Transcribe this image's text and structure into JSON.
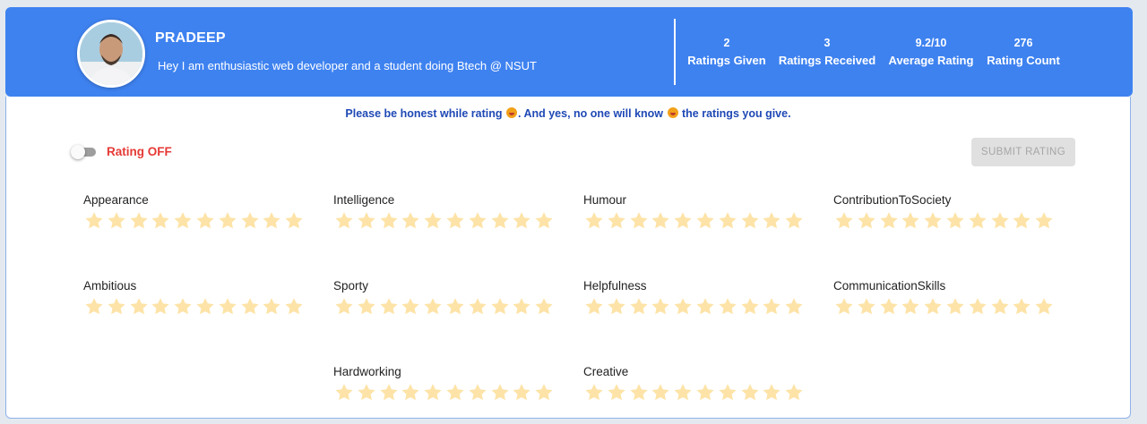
{
  "profile": {
    "name": "PRADEEP",
    "bio": "Hey I am enthusiastic web developer and a student doing Btech @ NSUT"
  },
  "stats": [
    {
      "value": "2",
      "label": "Ratings Given"
    },
    {
      "value": "3",
      "label": "Ratings Received"
    },
    {
      "value": "9.2/10",
      "label": "Average Rating"
    },
    {
      "value": "276",
      "label": "Rating Count"
    }
  ],
  "notice": {
    "part1": "Please be honest while rating",
    "part2": ". And yes, no one will know",
    "part3": "the ratings you give."
  },
  "toggle": {
    "label": "Rating OFF",
    "state": "off"
  },
  "submit_label": "SUBMIT RATING",
  "star_color": "#fde3a7",
  "max_stars": 10,
  "categories": [
    {
      "label": "Appearance",
      "rating": 0
    },
    {
      "label": "Intelligence",
      "rating": 0
    },
    {
      "label": "Humour",
      "rating": 0
    },
    {
      "label": "ContributionToSociety",
      "rating": 0
    },
    {
      "label": "Ambitious",
      "rating": 0
    },
    {
      "label": "Sporty",
      "rating": 0
    },
    {
      "label": "Helpfulness",
      "rating": 0
    },
    {
      "label": "CommunicationSkills",
      "rating": 0
    },
    {
      "label": "Hardworking",
      "rating": 0
    },
    {
      "label": "Creative",
      "rating": 0
    }
  ]
}
